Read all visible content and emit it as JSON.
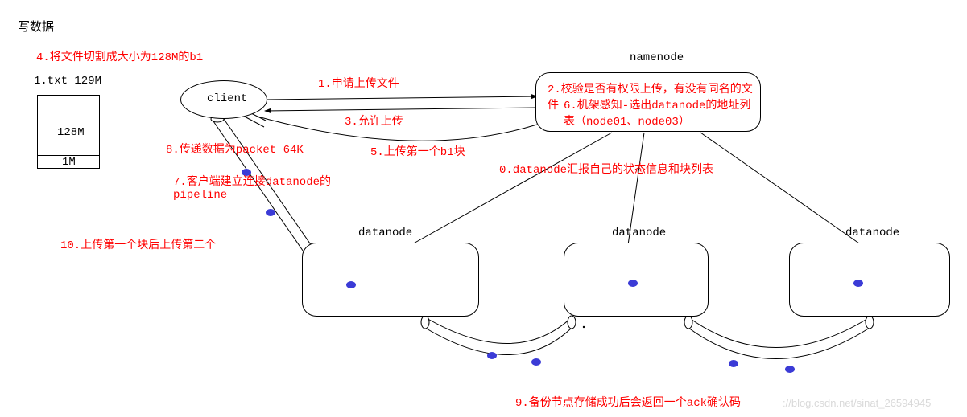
{
  "title": "写数据",
  "file": {
    "name": "1.txt 129M",
    "block_label": "128M",
    "remainder_label": "1M"
  },
  "nodes": {
    "client": "client",
    "namenode": "namenode",
    "datanode": "datanode"
  },
  "steps": {
    "s0": "0.datanode汇报自己的状态信息和块列表",
    "s1": "1.申请上传文件",
    "s2": "2.校验是否有权限上传，有没有同名的文件",
    "s3": "3.允许上传",
    "s4": "4.将文件切割成大小为128M的b1",
    "s5": "5.上传第一个b1块",
    "s6": "6.机架感知-选出datanode的地址列表（node01、node03）",
    "s7": "7.客户端建立连接datanode的pipeline",
    "s8": "8.传递数据为packet 64K",
    "s9": "9.备份节点存储成功后会返回一个ack确认码",
    "s10": "10.上传第一个块后上传第二个"
  },
  "watermark": "://blog.csdn.net/sinat_26594945"
}
